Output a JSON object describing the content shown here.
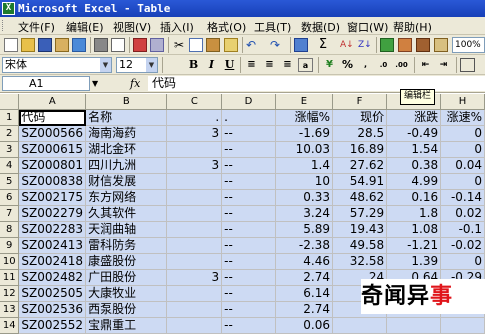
{
  "window": {
    "title": "Microsoft Excel - Table",
    "app_icon": "X"
  },
  "menu": [
    "文件(F)",
    "编辑(E)",
    "视图(V)",
    "插入(I)",
    "格式(O)",
    "工具(T)",
    "数据(D)",
    "窗口(W)",
    "帮助(H)"
  ],
  "toolbar": {
    "zoom": "100%",
    "font_name": "宋体",
    "font_size": "12",
    "bold": "B",
    "italic": "I",
    "underline": "U",
    "sigma": "Σ",
    "percent": "%"
  },
  "formula_bar": {
    "cell_ref": "A1",
    "fx": "fx",
    "content": "代码",
    "tooltip": "编辑栏"
  },
  "columns": [
    "A",
    "B",
    "C",
    "D",
    "E",
    "F",
    "G",
    "H"
  ],
  "rows": [
    {
      "n": "1",
      "a": "代码",
      "b": "名称",
      "c": ".",
      "d": ".",
      "e": "涨幅%",
      "f": "现价",
      "g": "涨跌",
      "h": "涨速%"
    },
    {
      "n": "2",
      "a": "SZ000566",
      "b": "海南海药",
      "c": "3",
      "d": "--",
      "e": "-1.69",
      "f": "28.5",
      "g": "-0.49",
      "h": "0"
    },
    {
      "n": "3",
      "a": "SZ000615",
      "b": "湖北金环",
      "c": "",
      "d": "--",
      "e": "10.03",
      "f": "16.89",
      "g": "1.54",
      "h": "0"
    },
    {
      "n": "4",
      "a": "SZ000801",
      "b": "四川九洲",
      "c": "3",
      "d": "--",
      "e": "1.4",
      "f": "27.62",
      "g": "0.38",
      "h": "0.04"
    },
    {
      "n": "5",
      "a": "SZ000838",
      "b": "财信发展",
      "c": "",
      "d": "--",
      "e": "10",
      "f": "54.91",
      "g": "4.99",
      "h": "0"
    },
    {
      "n": "6",
      "a": "SZ002175",
      "b": "东方网络",
      "c": "",
      "d": "--",
      "e": "0.33",
      "f": "48.62",
      "g": "0.16",
      "h": "-0.14"
    },
    {
      "n": "7",
      "a": "SZ002279",
      "b": "久其软件",
      "c": "",
      "d": "--",
      "e": "3.24",
      "f": "57.29",
      "g": "1.8",
      "h": "0.02"
    },
    {
      "n": "8",
      "a": "SZ002283",
      "b": "天润曲轴",
      "c": "",
      "d": "--",
      "e": "5.89",
      "f": "19.43",
      "g": "1.08",
      "h": "-0.1"
    },
    {
      "n": "9",
      "a": "SZ002413",
      "b": "雷科防务",
      "c": "",
      "d": "--",
      "e": "-2.38",
      "f": "49.58",
      "g": "-1.21",
      "h": "-0.02"
    },
    {
      "n": "10",
      "a": "SZ002418",
      "b": "康盛股份",
      "c": "",
      "d": "--",
      "e": "4.46",
      "f": "32.58",
      "g": "1.39",
      "h": "0"
    },
    {
      "n": "11",
      "a": "SZ002482",
      "b": "广田股份",
      "c": "3",
      "d": "--",
      "e": "2.74",
      "f": "24",
      "g": "0.64",
      "h": "-0.29"
    },
    {
      "n": "12",
      "a": "SZ002505",
      "b": "大康牧业",
      "c": "",
      "d": "--",
      "e": "6.14",
      "f": "8",
      "g": "",
      "h": ""
    },
    {
      "n": "13",
      "a": "SZ002536",
      "b": "西泵股份",
      "c": "",
      "d": "--",
      "e": "2.74",
      "f": "61.",
      "g": "",
      "h": ""
    },
    {
      "n": "14",
      "a": "SZ002552",
      "b": "宝鼎重工",
      "c": "",
      "d": "--",
      "e": "0.06",
      "f": "",
      "g": "",
      "h": ""
    }
  ],
  "watermark": {
    "black": "奇闻异",
    "red": "事"
  }
}
